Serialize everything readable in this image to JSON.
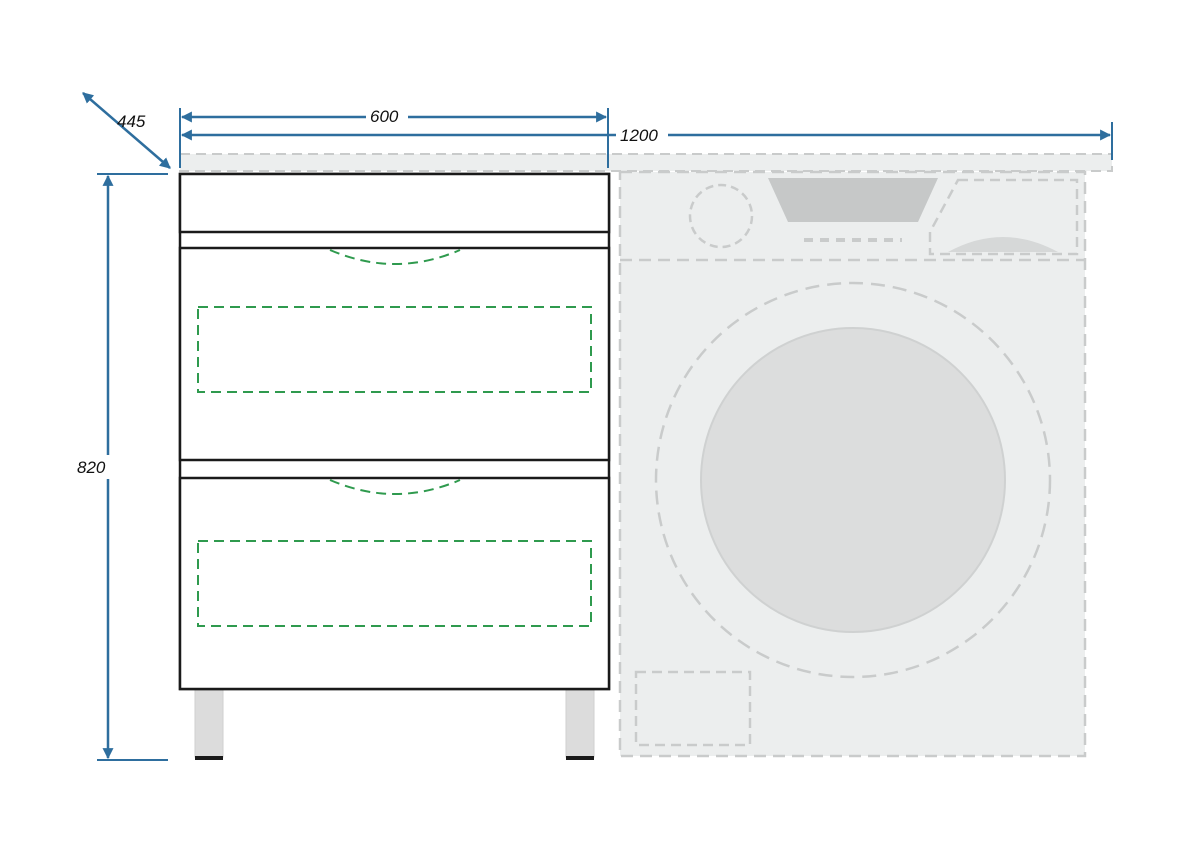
{
  "dimensions": {
    "depth": "445",
    "cabinet_width": "600",
    "total_width": "1200",
    "height": "820"
  },
  "colors": {
    "dimension_line": "#2e6e9e",
    "cabinet_outline": "#1a1a1a",
    "hidden_detail": "#2f9a4e",
    "appliance_fill": "#eceeee",
    "appliance_dash": "#c9cbcb",
    "drum_fill": "#dcdddd",
    "leg_fill": "#dcdcdc"
  },
  "icons": [
    "double-arrow-icon"
  ]
}
